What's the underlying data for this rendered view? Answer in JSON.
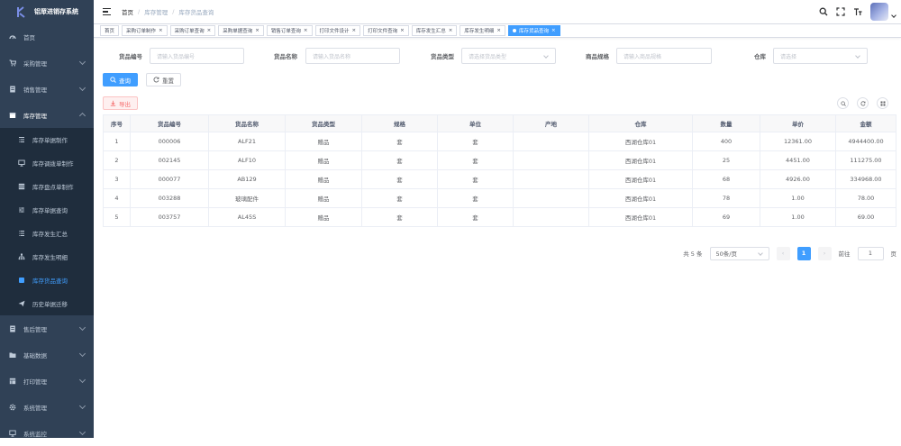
{
  "app": {
    "logo_text": "铝眾进销存系统"
  },
  "sidebar": {
    "items": [
      {
        "label": "首页",
        "icon": "dashboard-icon",
        "has_children": false
      },
      {
        "label": "采购管理",
        "icon": "cart-icon",
        "has_children": true
      },
      {
        "label": "销售管理",
        "icon": "document-icon",
        "has_children": true
      },
      {
        "label": "库存管理",
        "icon": "box-icon",
        "has_children": true,
        "open": true
      }
    ],
    "sub_items": [
      {
        "label": "库存单据制作",
        "icon": "list-icon"
      },
      {
        "label": "库存调拨单制作",
        "icon": "monitor-icon"
      },
      {
        "label": "库存盘点单制作",
        "icon": "grid-icon"
      },
      {
        "label": "库存单据查询",
        "icon": "filter-icon"
      },
      {
        "label": "库存发生汇总",
        "icon": "list-icon"
      },
      {
        "label": "库存发生明细",
        "icon": "tree-icon"
      },
      {
        "label": "库存货品查询",
        "icon": "tag-icon",
        "active": true
      },
      {
        "label": "历史单据迁移",
        "icon": "send-icon"
      }
    ],
    "bottom_items": [
      {
        "label": "售后管理",
        "icon": "document-icon"
      },
      {
        "label": "基础数据",
        "icon": "folder-icon"
      },
      {
        "label": "打印管理",
        "icon": "printer-icon"
      },
      {
        "label": "系统管理",
        "icon": "gear-icon"
      },
      {
        "label": "系统监控",
        "icon": "monitor-icon"
      }
    ]
  },
  "navbar": {
    "breadcrumb": [
      "首页",
      "库存管理",
      "库存货品查询"
    ]
  },
  "tags": [
    {
      "label": "首页",
      "closable": false
    },
    {
      "label": "采购订单制作",
      "closable": true
    },
    {
      "label": "采购订单查询",
      "closable": true
    },
    {
      "label": "采购单据查询",
      "closable": true
    },
    {
      "label": "销售订单查询",
      "closable": true
    },
    {
      "label": "打印文件设计",
      "closable": true
    },
    {
      "label": "打印文件查询",
      "closable": true
    },
    {
      "label": "库存发生汇总",
      "closable": true
    },
    {
      "label": "库存发生明细",
      "closable": true
    },
    {
      "label": "库存货品查询",
      "closable": true,
      "active": true
    }
  ],
  "search": {
    "code_label": "货品编号",
    "code_placeholder": "请输入货品编号",
    "name_label": "货品名称",
    "name_placeholder": "请输入货品名称",
    "type_label": "货品类型",
    "type_placeholder": "请选择货品类型",
    "spec_label": "商品规格",
    "spec_placeholder": "请输入商品规格",
    "warehouse_label": "仓库",
    "warehouse_placeholder": "请选择",
    "query_label": "查询",
    "reset_label": "重置",
    "export_label": "导出"
  },
  "table": {
    "columns": [
      "序号",
      "货品编号",
      "货品名称",
      "货品类型",
      "规格",
      "单位",
      "产地",
      "仓库",
      "数量",
      "单价",
      "金额"
    ],
    "rows": [
      [
        "1",
        "000006",
        "ALF21",
        "赠品",
        "套",
        "套",
        "",
        "西湖仓库01",
        "400",
        "12361.00",
        "4944400.00"
      ],
      [
        "2",
        "002145",
        "ALF10",
        "赠品",
        "套",
        "套",
        "",
        "西湖仓库01",
        "25",
        "4451.00",
        "111275.00"
      ],
      [
        "3",
        "000077",
        "AB129",
        "赠品",
        "套",
        "套",
        "",
        "西湖仓库01",
        "68",
        "4926.00",
        "334968.00"
      ],
      [
        "4",
        "003288",
        "玻璃配件",
        "赠品",
        "套",
        "套",
        "",
        "西湖仓库01",
        "78",
        "1.00",
        "78.00"
      ],
      [
        "5",
        "003757",
        "AL45S",
        "赠品",
        "套",
        "套",
        "",
        "西湖仓库01",
        "69",
        "1.00",
        "69.00"
      ]
    ]
  },
  "pagination": {
    "total_text": "共 5 条",
    "page_size": "50条/页",
    "current_page": "1",
    "goto_label": "前往",
    "goto_value": "1",
    "page_unit": "页"
  },
  "colors": {
    "sidebar_bg": "#304156",
    "sub_bg": "#1f2d3d",
    "primary": "#409eff",
    "danger": "#f56c6c"
  }
}
